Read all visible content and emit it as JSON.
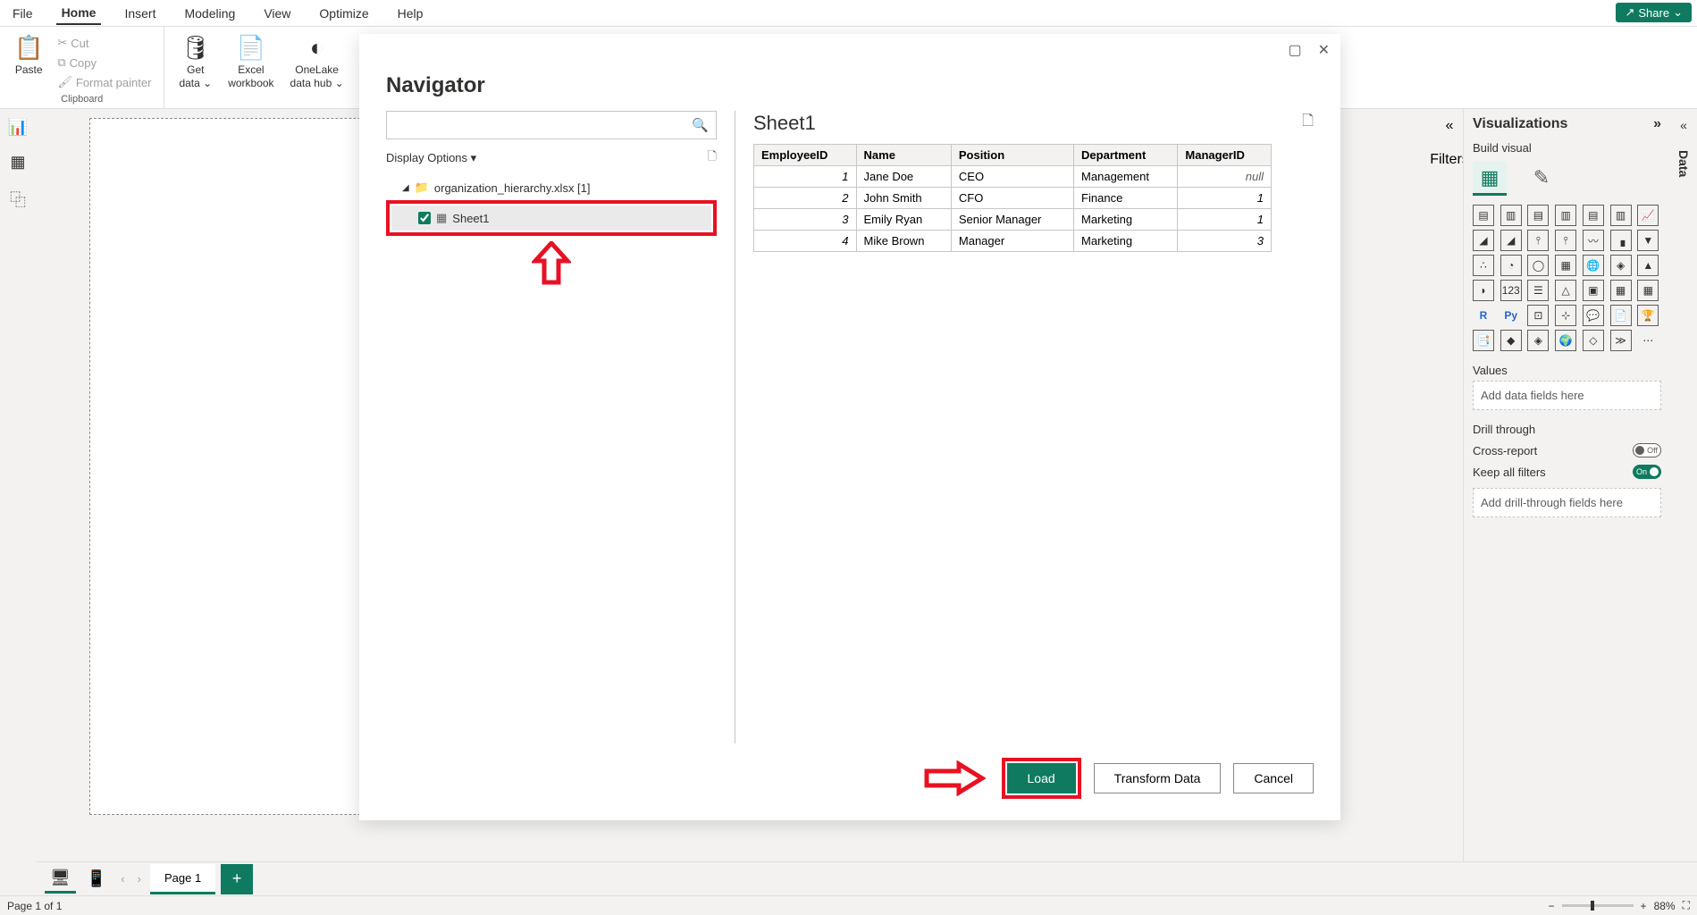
{
  "menu": {
    "items": [
      "File",
      "Home",
      "Insert",
      "Modeling",
      "View",
      "Optimize",
      "Help"
    ],
    "active": "Home",
    "share": "Share"
  },
  "ribbon": {
    "paste": "Paste",
    "cut": "Cut",
    "copy": "Copy",
    "format_painter": "Format painter",
    "clipboard_label": "Clipboard",
    "get_data": "Get",
    "get_data2": "data",
    "excel": "Excel",
    "excel2": "workbook",
    "onelake": "OneLake",
    "onelake2": "data hub"
  },
  "dialog": {
    "title": "Navigator",
    "search_placeholder": "",
    "display_options": "Display Options",
    "file_name": "organization_hierarchy.xlsx [1]",
    "sheet_name": "Sheet1",
    "preview_title": "Sheet1",
    "columns": [
      "EmployeeID",
      "Name",
      "Position",
      "Department",
      "ManagerID"
    ],
    "rows": [
      {
        "EmployeeID": "1",
        "Name": "Jane Doe",
        "Position": "CEO",
        "Department": "Management",
        "ManagerID": "null"
      },
      {
        "EmployeeID": "2",
        "Name": "John Smith",
        "Position": "CFO",
        "Department": "Finance",
        "ManagerID": "1"
      },
      {
        "EmployeeID": "3",
        "Name": "Emily Ryan",
        "Position": "Senior Manager",
        "Department": "Marketing",
        "ManagerID": "1"
      },
      {
        "EmployeeID": "4",
        "Name": "Mike Brown",
        "Position": "Manager",
        "Department": "Marketing",
        "ManagerID": "3"
      }
    ],
    "load": "Load",
    "transform": "Transform Data",
    "cancel": "Cancel"
  },
  "viz": {
    "title": "Visualizations",
    "build": "Build visual",
    "values": "Values",
    "values_placeholder": "Add data fields here",
    "drillthrough": "Drill through",
    "cross_report": "Cross-report",
    "keep_filters": "Keep all filters",
    "drill_placeholder": "Add drill-through fields here",
    "off": "Off",
    "on": "On"
  },
  "filters_label": "Filters",
  "data_label": "Data",
  "bottom": {
    "page": "Page 1"
  },
  "status": {
    "page_of": "Page 1 of 1",
    "zoom": "88%"
  }
}
